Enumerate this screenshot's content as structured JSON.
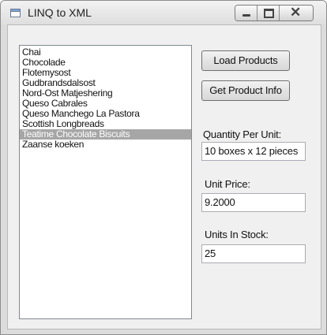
{
  "window": {
    "title": "LINQ to XML"
  },
  "products": {
    "items": [
      "Chai",
      "Chocolade",
      "Flotemysost",
      "Gudbrandsdalsost",
      "Nord-Ost Matjeshering",
      "Queso Cabrales",
      "Queso Manchego La Pastora",
      "Scottish Longbreads",
      "Teatime Chocolate Biscuits",
      "Zaanse koeken"
    ],
    "selected_index": 8
  },
  "buttons": {
    "load_label": "Load Products",
    "info_label": "Get Product Info"
  },
  "fields": {
    "quantity_label": "Quantity Per Unit:",
    "quantity_value": "10 boxes x 12 pieces",
    "price_label": "Unit Price:",
    "price_value": "9.2000",
    "stock_label": "Units In Stock:",
    "stock_value": "25"
  }
}
